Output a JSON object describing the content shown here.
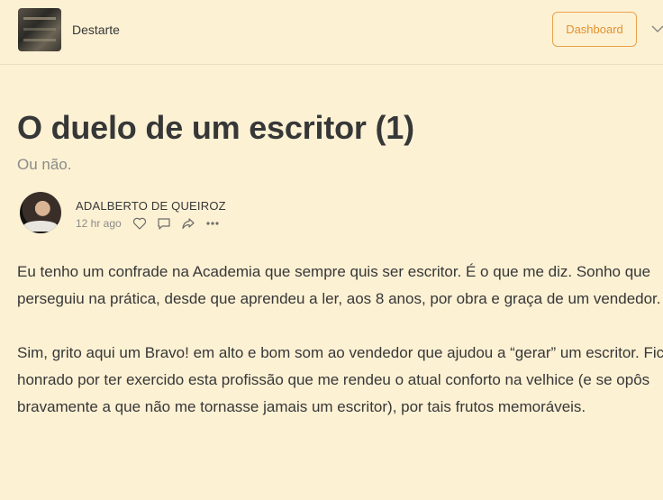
{
  "header": {
    "publication_name": "Destarte",
    "dashboard_label": "Dashboard"
  },
  "post": {
    "title": "O duelo de um escritor (1)",
    "subtitle": "Ou não.",
    "author": "ADALBERTO DE QUEIROZ",
    "timestamp": "12 hr ago",
    "paragraphs": [
      "Eu tenho um confrade na Academia que sempre quis ser escritor. É o que me diz. Sonho que perseguiu na prática, desde que aprendeu a ler, aos 8 anos, por obra e graça de um vendedor.",
      "Sim, grito aqui um Bravo! em alto e bom som ao vendedor que ajudou a “gerar” um escritor. Fico honrado por ter exercido esta profissão que me rendeu o atual conforto na velhice (e se opôs bravamente a que não me tornasse jamais um escritor), por tais frutos memoráveis."
    ]
  },
  "icons": {
    "like": "heart-icon",
    "comment": "comment-icon",
    "share": "share-icon",
    "more": "more-icon",
    "menu": "chevron-down-icon"
  },
  "colors": {
    "background": "#fdf1d4",
    "accent": "#e8a24a",
    "text": "#363737",
    "muted": "#8a8b87"
  }
}
